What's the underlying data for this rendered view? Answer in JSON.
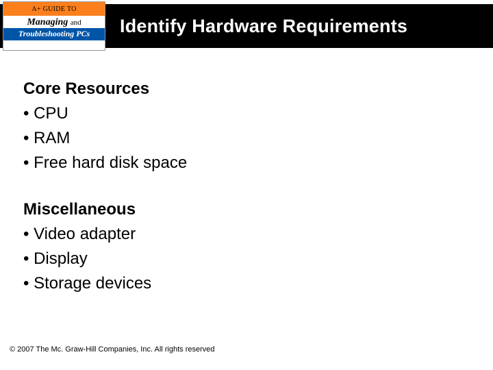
{
  "logo": {
    "top_line": "A+ GUIDE TO",
    "mid_line1": "Managing",
    "mid_line2_and": "and",
    "bot_line": "Troubleshooting PCs"
  },
  "header": {
    "title": "Identify Hardware Requirements"
  },
  "sections": [
    {
      "heading": "Core Resources",
      "items": [
        "CPU",
        "RAM",
        "Free hard disk space"
      ]
    },
    {
      "heading": "Miscellaneous",
      "items": [
        "Video adapter",
        "Display",
        "Storage devices"
      ]
    }
  ],
  "footer": {
    "copyright": "© 2007 The Mc. Graw-Hill Companies, Inc. All rights reserved"
  }
}
